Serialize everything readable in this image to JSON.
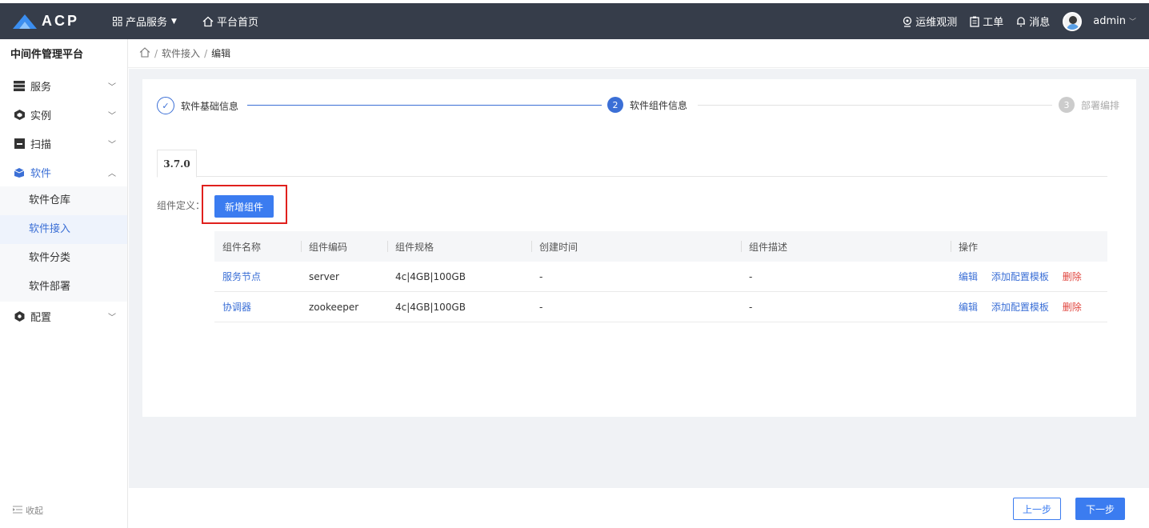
{
  "header": {
    "logo_text": "ACP",
    "products_label": "产品服务",
    "home_label": "平台首页",
    "ops_label": "运维观测",
    "ticket_label": "工单",
    "message_label": "消息",
    "user_name": "admin"
  },
  "sidebar": {
    "platform_title": "中间件管理平台",
    "items": [
      {
        "label": "服务",
        "icon": "server-icon"
      },
      {
        "label": "实例",
        "icon": "cube-icon"
      },
      {
        "label": "扫描",
        "icon": "scan-icon"
      },
      {
        "label": "软件",
        "icon": "box-icon"
      },
      {
        "label": "配置",
        "icon": "settings-icon"
      }
    ],
    "software_sub": [
      "软件仓库",
      "软件接入",
      "软件分类",
      "软件部署"
    ],
    "collapse_label": "收起"
  },
  "breadcrumb": {
    "parent": "软件接入",
    "current": "编辑"
  },
  "steps": [
    {
      "label": "软件基础信息",
      "number": "✓"
    },
    {
      "label": "软件组件信息",
      "number": "2"
    },
    {
      "label": "部署编排",
      "number": "3"
    }
  ],
  "tab": {
    "version": "3.7.0"
  },
  "components": {
    "definition_label": "组件定义：",
    "add_button": "新增组件",
    "columns": [
      "组件名称",
      "组件编码",
      "组件规格",
      "创建时间",
      "组件描述",
      "操作"
    ],
    "rows": [
      {
        "name": "服务节点",
        "code": "server",
        "spec": "4c|4GB|100GB",
        "created": "-",
        "desc": "-"
      },
      {
        "name": "协调器",
        "code": "zookeeper",
        "spec": "4c|4GB|100GB",
        "created": "-",
        "desc": "-"
      }
    ],
    "actions": {
      "edit": "编辑",
      "add_template": "添加配置模板",
      "delete": "删除"
    }
  },
  "footer": {
    "prev": "上一步",
    "next": "下一步"
  },
  "colors": {
    "primary": "#3b7cf0",
    "topbar": "#363d4a",
    "danger": "#e0443d",
    "highlight": "#e0201d"
  }
}
